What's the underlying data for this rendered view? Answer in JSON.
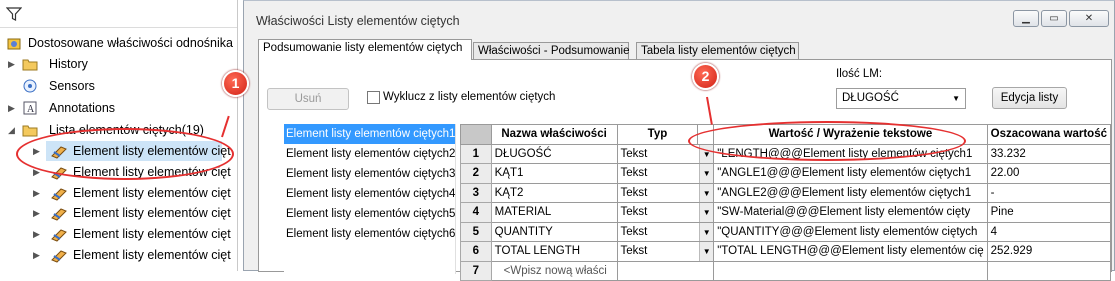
{
  "tree": {
    "items": [
      {
        "label": "Dostosowane właściwości odnośnika",
        "icon": "custom-properties-icon",
        "arrow": ""
      },
      {
        "label": "History",
        "icon": "history-folder-icon",
        "arrow": "▶"
      },
      {
        "label": "Sensors",
        "icon": "sensor-icon",
        "arrow": ""
      },
      {
        "label": "Annotations",
        "icon": "annotations-icon",
        "arrow": "▶"
      },
      {
        "label": "Lista elementów ciętych(19)",
        "icon": "cut-list-icon",
        "arrow": "◢"
      },
      {
        "label": "Element listy elementów cięt",
        "icon": "cut-list-item-icon",
        "arrow": "▶"
      },
      {
        "label": "Element listy elementów cięt",
        "icon": "cut-list-item-icon",
        "arrow": "▶"
      },
      {
        "label": "Element listy elementów cięt",
        "icon": "cut-list-item-icon",
        "arrow": "▶"
      },
      {
        "label": "Element listy elementów cięt",
        "icon": "cut-list-item-icon",
        "arrow": "▶"
      },
      {
        "label": "Element listy elementów cięt",
        "icon": "cut-list-item-icon",
        "arrow": "▶"
      },
      {
        "label": "Element listy elementów cięt",
        "icon": "cut-list-item-icon",
        "arrow": "▶"
      }
    ]
  },
  "dialog": {
    "title": "Właściwości Listy elementów ciętych",
    "tabs": [
      "Podsumowanie listy elementów ciętych",
      "Właściwości - Podsumowanie",
      "Tabela listy elementów ciętych"
    ],
    "delete_button": "Usuń",
    "exclude_label": "Wyklucz z listy elementów ciętych",
    "qty_label": "Ilość LM:",
    "qty_value": "DŁUGOŚĆ",
    "edit_list_button": "Edycja listy",
    "cut_items": [
      "Element listy elementów ciętych1",
      "Element listy elementów ciętych2",
      "Element listy elementów ciętych3",
      "Element listy elementów ciętych4",
      "Element listy elementów ciętych5",
      "Element listy elementów ciętych6"
    ],
    "columns": [
      "Nazwa właściwości",
      "Typ",
      "Wartość / Wyrażenie tekstowe",
      "Oszacowana wartość"
    ],
    "rows": [
      {
        "n": "1",
        "name": "DŁUGOŚĆ",
        "type": "Tekst",
        "value": "\"LENGTH@@@Element listy elementów ciętych1",
        "evaluated": "33.232"
      },
      {
        "n": "2",
        "name": "KĄT1",
        "type": "Tekst",
        "value": "\"ANGLE1@@@Element listy elementów ciętych1",
        "evaluated": "22.00"
      },
      {
        "n": "3",
        "name": "KĄT2",
        "type": "Tekst",
        "value": "\"ANGLE2@@@Element listy elementów ciętych1",
        "evaluated": "-"
      },
      {
        "n": "4",
        "name": "MATERIAL",
        "type": "Tekst",
        "value": "\"SW-Material@@@Element listy elementów cięty",
        "evaluated": "Pine"
      },
      {
        "n": "5",
        "name": "QUANTITY",
        "type": "Tekst",
        "value": "\"QUANTITY@@@Element listy elementów ciętych",
        "evaluated": "4"
      },
      {
        "n": "6",
        "name": "TOTAL LENGTH",
        "type": "Tekst",
        "value": "\"TOTAL LENGTH@@@Element listy elementów cię",
        "evaluated": "252.929"
      },
      {
        "n": "7",
        "name": "<Wpisz nową właści",
        "type": "",
        "value": "",
        "evaluated": ""
      }
    ]
  },
  "callouts": [
    "1",
    "2"
  ],
  "colors": {
    "callout": "#e53030",
    "selection": "#3399ff",
    "tree_selection": "#cde4f7"
  }
}
